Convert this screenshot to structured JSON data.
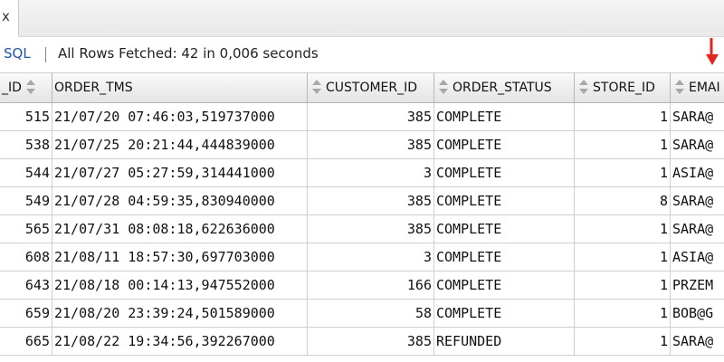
{
  "tab": {
    "close_glyph": "x"
  },
  "toolbar": {
    "sql_label": "SQL",
    "status": "All Rows Fetched: 42 in 0,006 seconds"
  },
  "columns": [
    "_ID",
    "ORDER_TMS",
    "CUSTOMER_ID",
    "ORDER_STATUS",
    "STORE_ID",
    "EMAI"
  ],
  "rows": [
    [
      "515",
      "21/07/20  07:46:03,519737000",
      "385",
      "COMPLETE",
      "1",
      "SARA@"
    ],
    [
      "538",
      "21/07/25  20:21:44,444839000",
      "385",
      "COMPLETE",
      "1",
      "SARA@"
    ],
    [
      "544",
      "21/07/27  05:27:59,314441000",
      "3",
      "COMPLETE",
      "1",
      "ASIA@"
    ],
    [
      "549",
      "21/07/28  04:59:35,830940000",
      "385",
      "COMPLETE",
      "8",
      "SARA@"
    ],
    [
      "565",
      "21/07/31  08:08:18,622636000",
      "385",
      "COMPLETE",
      "1",
      "SARA@"
    ],
    [
      "608",
      "21/08/11  18:57:30,697703000",
      "3",
      "COMPLETE",
      "1",
      "ASIA@"
    ],
    [
      "643",
      "21/08/18  00:14:13,947552000",
      "166",
      "COMPLETE",
      "1",
      "PRZEM"
    ],
    [
      "659",
      "21/08/20  23:39:24,501589000",
      "58",
      "COMPLETE",
      "1",
      "BOB@G"
    ],
    [
      "665",
      "21/08/22  19:34:56,392267000",
      "385",
      "REFUNDED",
      "1",
      "SARA@"
    ]
  ],
  "colors": {
    "accent_arrow": "#e0281e",
    "sql_link": "#2255aa"
  },
  "icons": {
    "sort": "sort-arrows-icon",
    "annotation": "red-arrow-icon"
  }
}
